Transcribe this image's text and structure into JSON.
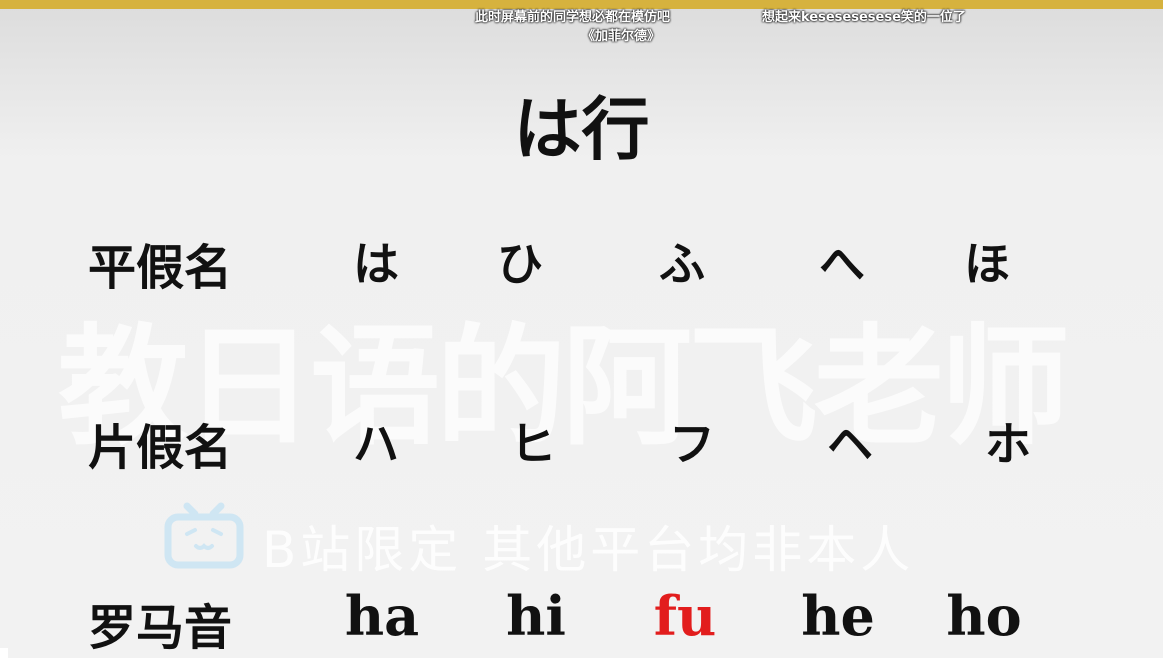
{
  "danmaku": [
    "此时屏幕前的同学想必都在模仿吧",
    "《加菲尔德》",
    "想起来kesesesesese笑的一位了"
  ],
  "title": "は行",
  "watermark": "教日语的阿飞老师",
  "platform_notice": "B站限定 其他平台均非本人",
  "rows": [
    {
      "label": "平假名",
      "cells": [
        "は",
        "ひ",
        "ふ",
        "へ",
        "ほ"
      ]
    },
    {
      "label": "片假名",
      "cells": [
        "ハ",
        "ヒ",
        "フ",
        "ヘ",
        "ホ"
      ]
    },
    {
      "label": "罗马音",
      "cells": [
        "ha",
        "hi",
        "fu",
        "he",
        "ho"
      ]
    }
  ],
  "colors": {
    "accent_bar": "#d6b23e",
    "highlight": "#e21d1d",
    "text": "#111111"
  },
  "icons": {
    "logo": "bilibili-tv-icon"
  }
}
